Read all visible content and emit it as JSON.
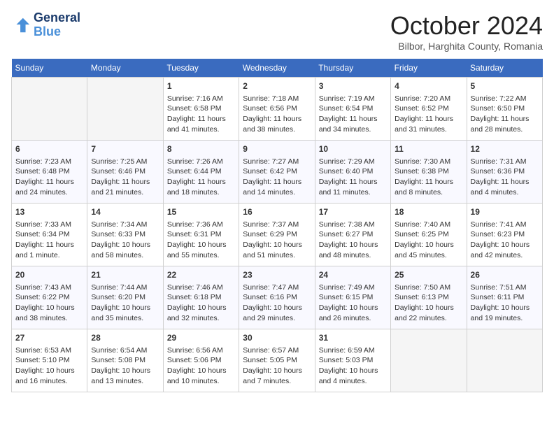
{
  "header": {
    "logo_line1": "General",
    "logo_line2": "Blue",
    "month_title": "October 2024",
    "location": "Bilbor, Harghita County, Romania"
  },
  "weekdays": [
    "Sunday",
    "Monday",
    "Tuesday",
    "Wednesday",
    "Thursday",
    "Friday",
    "Saturday"
  ],
  "weeks": [
    [
      {
        "day": "",
        "empty": true
      },
      {
        "day": "",
        "empty": true
      },
      {
        "day": "1",
        "sunrise": "Sunrise: 7:16 AM",
        "sunset": "Sunset: 6:58 PM",
        "daylight": "Daylight: 11 hours and 41 minutes."
      },
      {
        "day": "2",
        "sunrise": "Sunrise: 7:18 AM",
        "sunset": "Sunset: 6:56 PM",
        "daylight": "Daylight: 11 hours and 38 minutes."
      },
      {
        "day": "3",
        "sunrise": "Sunrise: 7:19 AM",
        "sunset": "Sunset: 6:54 PM",
        "daylight": "Daylight: 11 hours and 34 minutes."
      },
      {
        "day": "4",
        "sunrise": "Sunrise: 7:20 AM",
        "sunset": "Sunset: 6:52 PM",
        "daylight": "Daylight: 11 hours and 31 minutes."
      },
      {
        "day": "5",
        "sunrise": "Sunrise: 7:22 AM",
        "sunset": "Sunset: 6:50 PM",
        "daylight": "Daylight: 11 hours and 28 minutes."
      }
    ],
    [
      {
        "day": "6",
        "sunrise": "Sunrise: 7:23 AM",
        "sunset": "Sunset: 6:48 PM",
        "daylight": "Daylight: 11 hours and 24 minutes."
      },
      {
        "day": "7",
        "sunrise": "Sunrise: 7:25 AM",
        "sunset": "Sunset: 6:46 PM",
        "daylight": "Daylight: 11 hours and 21 minutes."
      },
      {
        "day": "8",
        "sunrise": "Sunrise: 7:26 AM",
        "sunset": "Sunset: 6:44 PM",
        "daylight": "Daylight: 11 hours and 18 minutes."
      },
      {
        "day": "9",
        "sunrise": "Sunrise: 7:27 AM",
        "sunset": "Sunset: 6:42 PM",
        "daylight": "Daylight: 11 hours and 14 minutes."
      },
      {
        "day": "10",
        "sunrise": "Sunrise: 7:29 AM",
        "sunset": "Sunset: 6:40 PM",
        "daylight": "Daylight: 11 hours and 11 minutes."
      },
      {
        "day": "11",
        "sunrise": "Sunrise: 7:30 AM",
        "sunset": "Sunset: 6:38 PM",
        "daylight": "Daylight: 11 hours and 8 minutes."
      },
      {
        "day": "12",
        "sunrise": "Sunrise: 7:31 AM",
        "sunset": "Sunset: 6:36 PM",
        "daylight": "Daylight: 11 hours and 4 minutes."
      }
    ],
    [
      {
        "day": "13",
        "sunrise": "Sunrise: 7:33 AM",
        "sunset": "Sunset: 6:34 PM",
        "daylight": "Daylight: 11 hours and 1 minute."
      },
      {
        "day": "14",
        "sunrise": "Sunrise: 7:34 AM",
        "sunset": "Sunset: 6:33 PM",
        "daylight": "Daylight: 10 hours and 58 minutes."
      },
      {
        "day": "15",
        "sunrise": "Sunrise: 7:36 AM",
        "sunset": "Sunset: 6:31 PM",
        "daylight": "Daylight: 10 hours and 55 minutes."
      },
      {
        "day": "16",
        "sunrise": "Sunrise: 7:37 AM",
        "sunset": "Sunset: 6:29 PM",
        "daylight": "Daylight: 10 hours and 51 minutes."
      },
      {
        "day": "17",
        "sunrise": "Sunrise: 7:38 AM",
        "sunset": "Sunset: 6:27 PM",
        "daylight": "Daylight: 10 hours and 48 minutes."
      },
      {
        "day": "18",
        "sunrise": "Sunrise: 7:40 AM",
        "sunset": "Sunset: 6:25 PM",
        "daylight": "Daylight: 10 hours and 45 minutes."
      },
      {
        "day": "19",
        "sunrise": "Sunrise: 7:41 AM",
        "sunset": "Sunset: 6:23 PM",
        "daylight": "Daylight: 10 hours and 42 minutes."
      }
    ],
    [
      {
        "day": "20",
        "sunrise": "Sunrise: 7:43 AM",
        "sunset": "Sunset: 6:22 PM",
        "daylight": "Daylight: 10 hours and 38 minutes."
      },
      {
        "day": "21",
        "sunrise": "Sunrise: 7:44 AM",
        "sunset": "Sunset: 6:20 PM",
        "daylight": "Daylight: 10 hours and 35 minutes."
      },
      {
        "day": "22",
        "sunrise": "Sunrise: 7:46 AM",
        "sunset": "Sunset: 6:18 PM",
        "daylight": "Daylight: 10 hours and 32 minutes."
      },
      {
        "day": "23",
        "sunrise": "Sunrise: 7:47 AM",
        "sunset": "Sunset: 6:16 PM",
        "daylight": "Daylight: 10 hours and 29 minutes."
      },
      {
        "day": "24",
        "sunrise": "Sunrise: 7:49 AM",
        "sunset": "Sunset: 6:15 PM",
        "daylight": "Daylight: 10 hours and 26 minutes."
      },
      {
        "day": "25",
        "sunrise": "Sunrise: 7:50 AM",
        "sunset": "Sunset: 6:13 PM",
        "daylight": "Daylight: 10 hours and 22 minutes."
      },
      {
        "day": "26",
        "sunrise": "Sunrise: 7:51 AM",
        "sunset": "Sunset: 6:11 PM",
        "daylight": "Daylight: 10 hours and 19 minutes."
      }
    ],
    [
      {
        "day": "27",
        "sunrise": "Sunrise: 6:53 AM",
        "sunset": "Sunset: 5:10 PM",
        "daylight": "Daylight: 10 hours and 16 minutes."
      },
      {
        "day": "28",
        "sunrise": "Sunrise: 6:54 AM",
        "sunset": "Sunset: 5:08 PM",
        "daylight": "Daylight: 10 hours and 13 minutes."
      },
      {
        "day": "29",
        "sunrise": "Sunrise: 6:56 AM",
        "sunset": "Sunset: 5:06 PM",
        "daylight": "Daylight: 10 hours and 10 minutes."
      },
      {
        "day": "30",
        "sunrise": "Sunrise: 6:57 AM",
        "sunset": "Sunset: 5:05 PM",
        "daylight": "Daylight: 10 hours and 7 minutes."
      },
      {
        "day": "31",
        "sunrise": "Sunrise: 6:59 AM",
        "sunset": "Sunset: 5:03 PM",
        "daylight": "Daylight: 10 hours and 4 minutes."
      },
      {
        "day": "",
        "empty": true
      },
      {
        "day": "",
        "empty": true
      }
    ]
  ]
}
